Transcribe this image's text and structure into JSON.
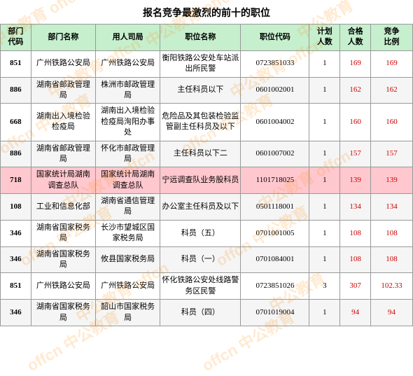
{
  "title": "报名竞争最激烈的前十的职位",
  "headers": {
    "row1": [
      "部门代码",
      "部门名称",
      "用人司局",
      "职位名称",
      "职位代码",
      "计划人数",
      "合格人数",
      "竞争比例"
    ]
  },
  "rows": [
    {
      "dept_code": "851",
      "dept_name": "广州铁路公安局",
      "employer": "广州铁路公安局",
      "job_name": "衡阳铁路公安处车站派出所民警",
      "job_code": "0723851033",
      "plan": "1",
      "pass": "169",
      "compete": "169",
      "highlight": false
    },
    {
      "dept_code": "886",
      "dept_name": "湖南省邮政管理局",
      "employer": "株洲市邮政管理局",
      "job_name": "主任科员以下",
      "job_code": "0601002001",
      "plan": "1",
      "pass": "162",
      "compete": "162",
      "highlight": false
    },
    {
      "dept_code": "668",
      "dept_name": "湖南出入境检验检疫局",
      "employer": "湖南出入境检验检疫局洵阳办事处",
      "job_name": "危险品及其包装检验监管副主任科员及以下",
      "job_code": "0601004002",
      "plan": "1",
      "pass": "160",
      "compete": "160",
      "highlight": false
    },
    {
      "dept_code": "886",
      "dept_name": "湖南省邮政管理局",
      "employer": "怀化市邮政管理局",
      "job_name": "主任科员以下二",
      "job_code": "0601007002",
      "plan": "1",
      "pass": "157",
      "compete": "157",
      "highlight": false
    },
    {
      "dept_code": "718",
      "dept_name": "国家统计局湖南调查总队",
      "employer": "国家统计局湖南调查总队",
      "job_name": "宁远调查队业务股科员",
      "job_code": "1101718025",
      "plan": "1",
      "pass": "139",
      "compete": "139",
      "highlight": true
    },
    {
      "dept_code": "108",
      "dept_name": "工业和信息化部",
      "employer": "湖南省通信管理局",
      "job_name": "办公室主任科员及以下",
      "job_code": "0501118001",
      "plan": "1",
      "pass": "134",
      "compete": "134",
      "highlight": false
    },
    {
      "dept_code": "346",
      "dept_name": "湖南省国家税务局",
      "employer": "长沙市望城区国家税务局",
      "job_name": "科员（五）",
      "job_code": "0701001005",
      "plan": "1",
      "pass": "108",
      "compete": "108",
      "highlight": false
    },
    {
      "dept_code": "346",
      "dept_name": "湖南省国家税务局",
      "employer": "攸县国家税务局",
      "job_name": "科员（一）",
      "job_code": "0701084001",
      "plan": "1",
      "pass": "108",
      "compete": "108",
      "highlight": false
    },
    {
      "dept_code": "851",
      "dept_name": "广州铁路公安局",
      "employer": "广州铁路公安局",
      "job_name": "怀化铁路公安处线路警务区民警",
      "job_code": "0723851026",
      "plan": "3",
      "pass": "307",
      "compete": "102.33",
      "highlight": false
    },
    {
      "dept_code": "346",
      "dept_name": "湖南省国家税务局",
      "employer": "韶山市国家税务局",
      "job_name": "科员（四）",
      "job_code": "0701019004",
      "plan": "1",
      "pass": "94",
      "compete": "94",
      "highlight": false
    }
  ]
}
